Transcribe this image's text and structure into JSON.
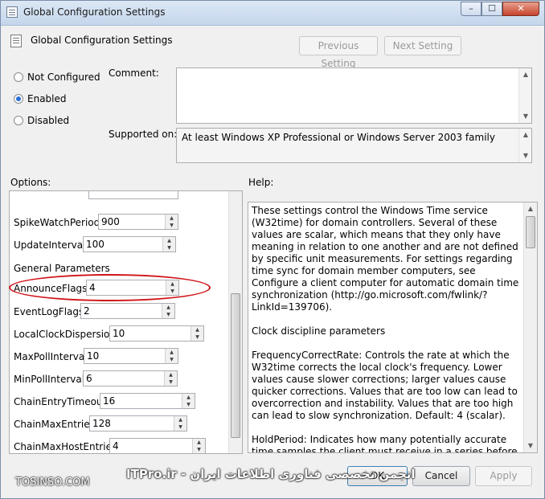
{
  "window": {
    "title": "Global Configuration Settings",
    "controls": {
      "minimize": "–",
      "maximize": "☐",
      "close": "✕"
    }
  },
  "header": {
    "title": "Global Configuration Settings",
    "previous_label": "Previous Setting",
    "next_label": "Next Setting"
  },
  "state": {
    "options": [
      {
        "label": "Not Configured",
        "checked": false
      },
      {
        "label": "Enabled",
        "checked": true
      },
      {
        "label": "Disabled",
        "checked": false
      }
    ]
  },
  "comment": {
    "label": "Comment:",
    "value": ""
  },
  "supported": {
    "label": "Supported on:",
    "value": "At least Windows XP Professional or Windows Server 2003 family"
  },
  "options_panel": {
    "label": "Options:",
    "rows": [
      {
        "label": "SpikeWatchPeriod",
        "value": "900"
      },
      {
        "label": "UpdateInterval",
        "value": "100"
      },
      {
        "label": "General Parameters",
        "value": null
      },
      {
        "label": "AnnounceFlags",
        "value": "4"
      },
      {
        "label": "EventLogFlags",
        "value": "2"
      },
      {
        "label": "LocalClockDispersion",
        "value": "10"
      },
      {
        "label": "MaxPollInterval",
        "value": "10"
      },
      {
        "label": "MinPollInterval",
        "value": "6"
      },
      {
        "label": "ChainEntryTimeout",
        "value": "16"
      },
      {
        "label": "ChainMaxEntries",
        "value": "128"
      },
      {
        "label": "ChainMaxHostEntries",
        "value": "4"
      }
    ]
  },
  "help_panel": {
    "label": "Help:",
    "paragraphs": [
      "These settings control the Windows Time service (W32time) for domain controllers. Several of these values are scalar, which means that they only have meaning in relation to one another and are not defined by specific unit measurements. For settings regarding time sync for domain member computers, see Configure a client computer for automatic domain time synchronization (http://go.microsoft.com/fwlink/?LinkId=139706).",
      "Clock discipline parameters",
      "FrequencyCorrectRate: Controls the rate at which the W32time corrects the local clock's frequency. Lower values cause slower corrections; larger values cause quicker corrections. Values that are too low can lead to overcorrection and instability. Values that are too high can lead to slow synchronization. Default: 4 (scalar).",
      "HoldPeriod: Indicates how many potentially accurate time samples the client must receive in a series before subsequent time samples are evaluated as potential spikes. After a period of not receiving any usable time samples, a time client ceases to"
    ]
  },
  "footer": {
    "ok_label": "OK",
    "cancel_label": "Cancel",
    "apply_label": "Apply"
  },
  "watermark": {
    "site": "TOSINSO.COM",
    "arabic": "انجمن تخصصی فناوری اطلاعات ایران - ITPro.ir"
  },
  "colors": {
    "highlight": "#d0141a",
    "radio_dot": "#2a6fd6"
  }
}
